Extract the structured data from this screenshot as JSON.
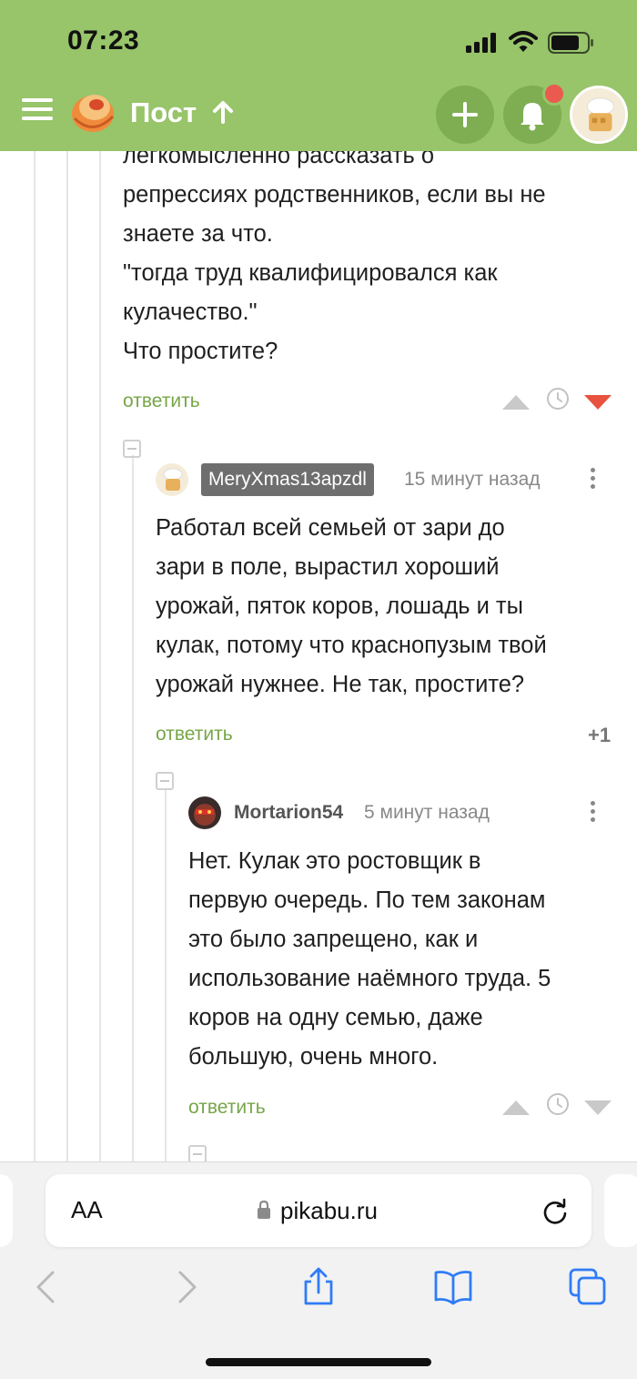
{
  "status_bar": {
    "time": "07:23"
  },
  "header": {
    "title": "Пост"
  },
  "comments": [
    {
      "text": "легкомысленно рассказать о\nрепрессиях родственников, если вы не\nзнаете за что.\n\"тогда труд квалифицировался как\nкулачество.\"\nЧто простите?",
      "reply_label": "ответить",
      "vote_state": "down"
    },
    {
      "author": "MeryXmas13apzdl",
      "time": "15 минут назад",
      "text": "Работал всей семьей от зари до\nзари в поле, вырастил хороший\nурожай, пяток коров, лошадь и ты\nкулак, потому что краснопузым твой\nурожай нужнее. Не так, простите?",
      "reply_label": "ответить",
      "rating": "+1"
    },
    {
      "author": "Mortarion54",
      "time": "5 минут назад",
      "text": "Нет. Кулак это ростовщик в\nпервую очередь. По тем законам\nэто было запрещено, как и\nиспользование наёмного труда. 5\nкоров на одну семью, даже\nбольшую, очень много.",
      "reply_label": "ответить"
    }
  ],
  "browser": {
    "aa_label": "AA",
    "url": "pikabu.ru"
  },
  "colors": {
    "header_bg": "#98c46a",
    "reply_link": "#77a647",
    "downvote_active": "#e8523f",
    "notification_dot": "#ea5a4f",
    "ios_blue": "#2f7cf6"
  },
  "icons": [
    "menu-icon",
    "pikabu-logo",
    "arrow-up-icon",
    "plus-icon",
    "bell-icon",
    "clock-icon",
    "upvote-icon",
    "downvote-icon",
    "more-icon",
    "lock-icon",
    "reload-icon",
    "back-icon",
    "forward-icon",
    "share-icon",
    "bookmarks-icon",
    "tabs-icon"
  ]
}
